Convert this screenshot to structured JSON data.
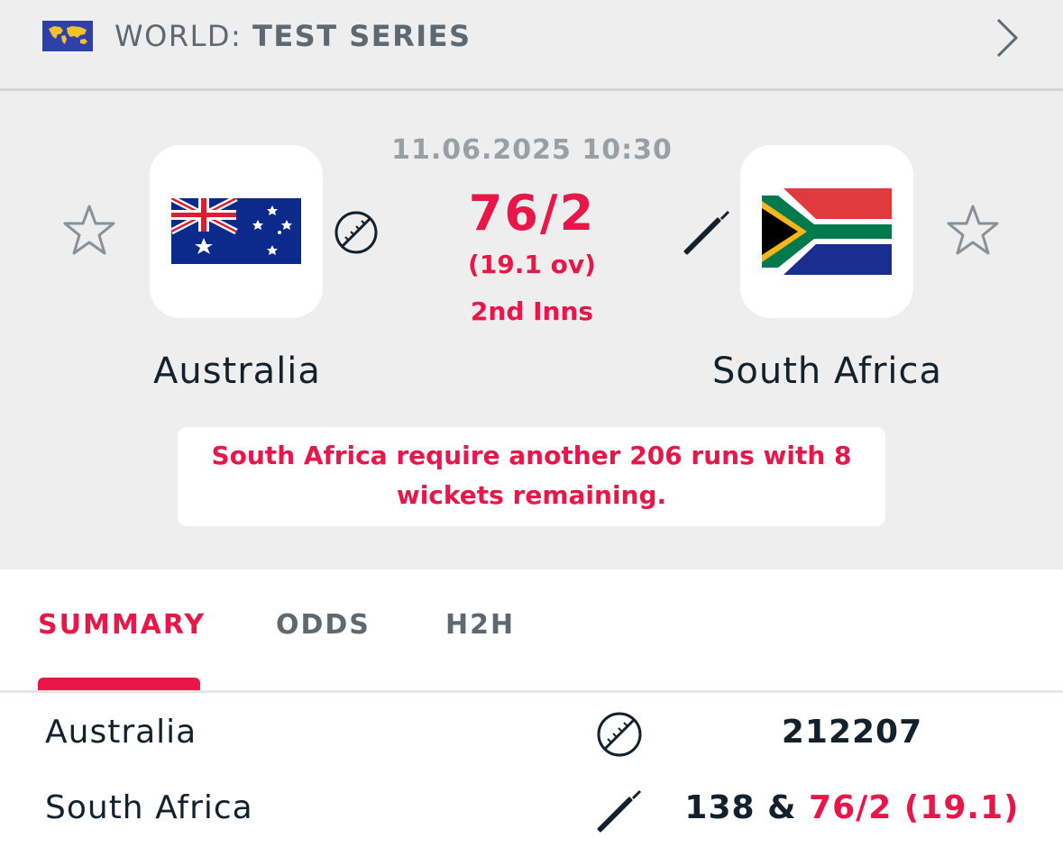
{
  "header": {
    "country": "WORLD:",
    "competition": "TEST SERIES"
  },
  "match": {
    "datetime": "11.06.2025 10:30",
    "score": "76/2",
    "overs": "(19.1 ov)",
    "innings": "2nd Inns",
    "home": {
      "name": "Australia"
    },
    "away": {
      "name": "South Africa"
    },
    "info": "South Africa require another 206 runs with 8 wickets remaining."
  },
  "tabs": [
    {
      "label": "SUMMARY",
      "active": true
    },
    {
      "label": "ODDS",
      "active": false
    },
    {
      "label": "H2H",
      "active": false
    }
  ],
  "scoreboard": [
    {
      "team": "Australia",
      "icon": "cricket-ball-icon",
      "score": "212207",
      "live": ""
    },
    {
      "team": "South Africa",
      "icon": "cricket-bat-icon",
      "score": "138 & ",
      "live": "76/2 (19.1)"
    }
  ],
  "colors": {
    "accent": "#e8174a",
    "text": "#12212c",
    "muted": "#5d6871",
    "background": "#eeeeee"
  }
}
